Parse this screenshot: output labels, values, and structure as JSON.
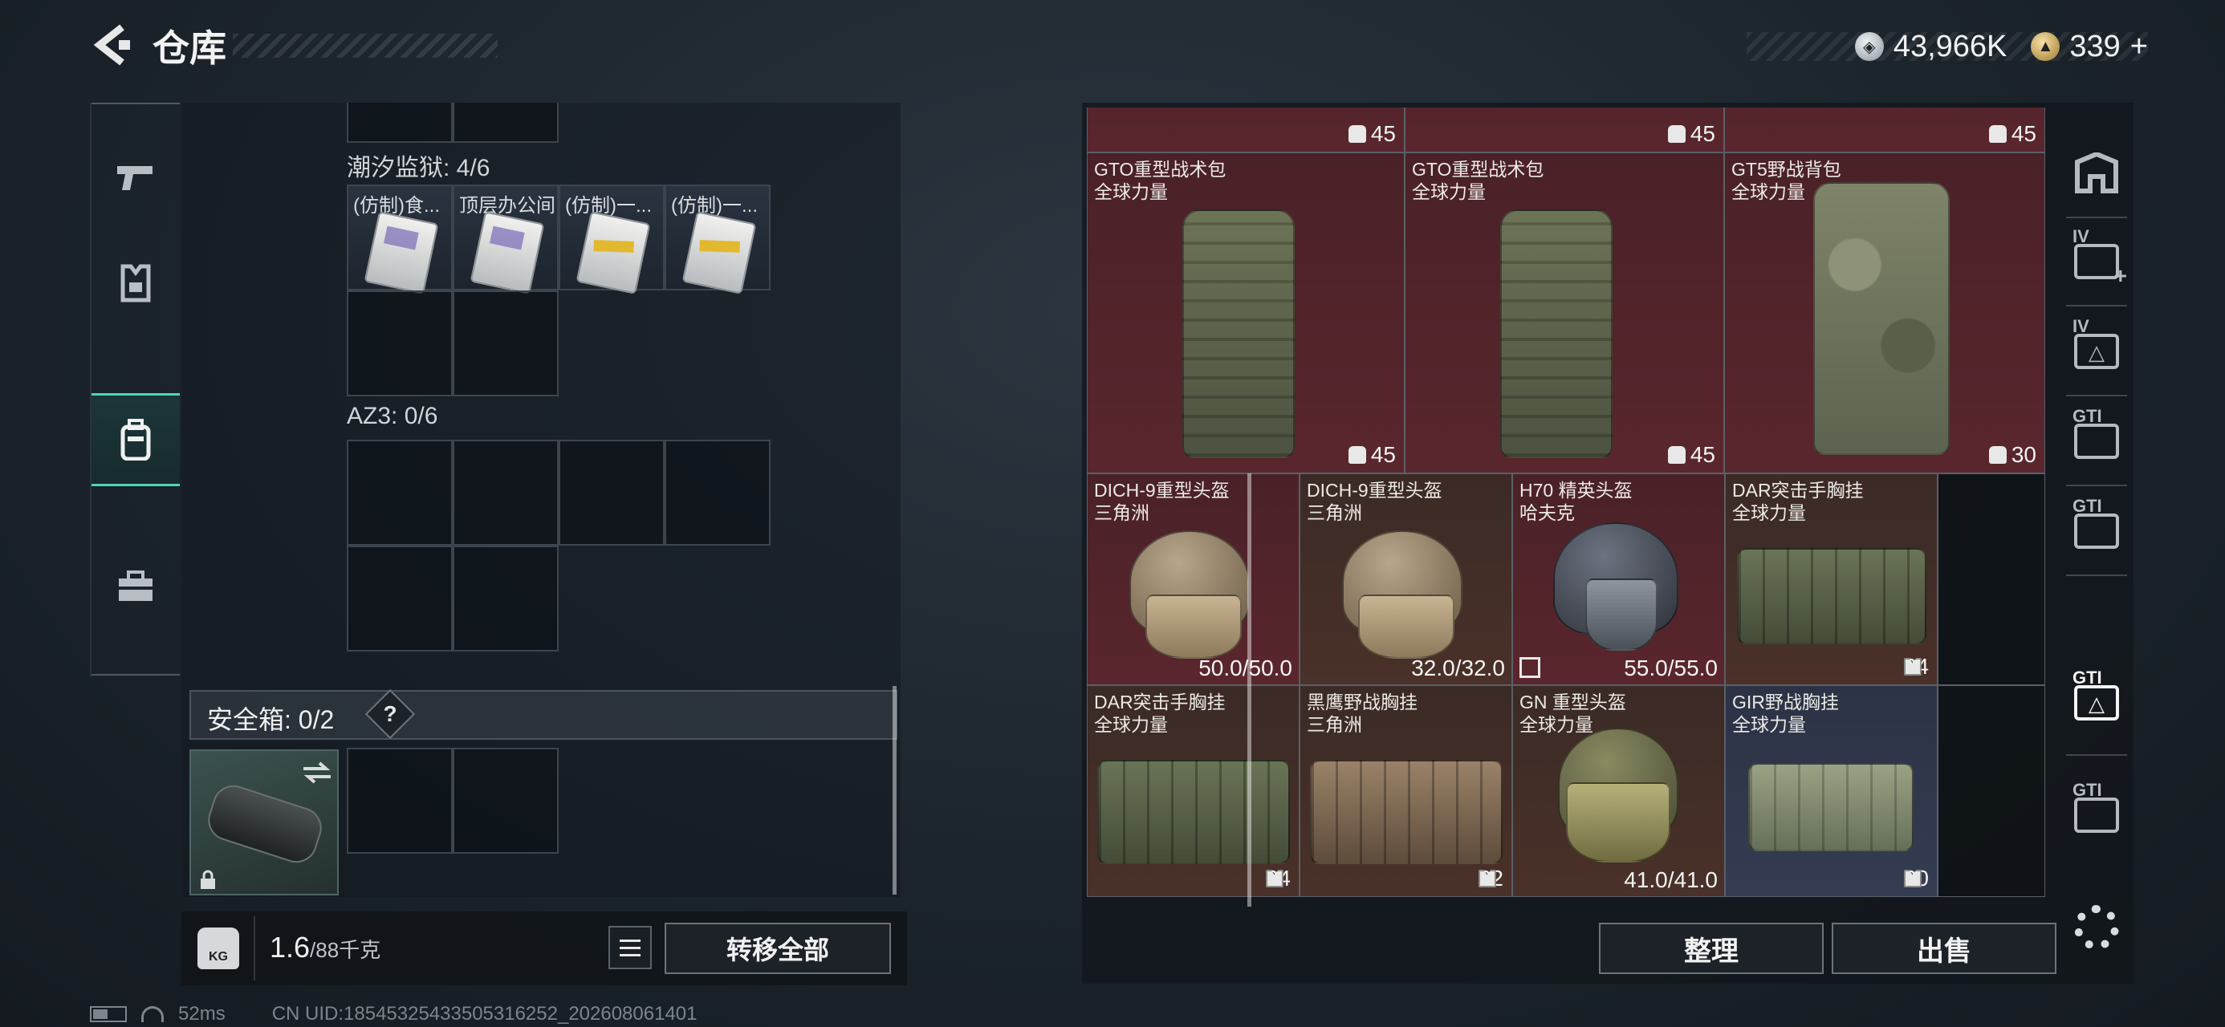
{
  "header": {
    "title": "仓库",
    "currency": [
      {
        "icon": "silver-coin-icon",
        "value": "43,966K"
      },
      {
        "icon": "gold-coin-icon",
        "value": "339",
        "suffix": "+"
      }
    ]
  },
  "left_rail": {
    "items": [
      {
        "icon": "pistol-icon",
        "active": false
      },
      {
        "icon": "armor-rig-icon",
        "active": false
      },
      {
        "icon": "backpack-icon",
        "active": true
      },
      {
        "icon": "toolbox-icon",
        "active": false
      }
    ]
  },
  "containers": [
    {
      "label": "潮汐监狱: 4/6",
      "items": [
        "(仿制)食...",
        "顶层办公间",
        "(仿制)一...",
        "(仿制)一..."
      ]
    },
    {
      "label": "AZ3: 0/6",
      "items": []
    }
  ],
  "safebox": {
    "label": "安全箱: 0/2",
    "help": "?"
  },
  "footer_bar": {
    "weight_icon_text": "KG",
    "weight_current": "1.6",
    "weight_max": "/88千克",
    "transfer_all": "转移全部"
  },
  "stash": {
    "top_row_badges": [
      "45",
      "45",
      "45"
    ],
    "items": [
      {
        "name": "GTO重型战术包",
        "faction": "全球力量",
        "value": "45",
        "kind": "backpack",
        "bg": "red"
      },
      {
        "name": "GTO重型战术包",
        "faction": "全球力量",
        "value": "45",
        "kind": "backpack",
        "bg": "red"
      },
      {
        "name": "GT5野战背包",
        "faction": "全球力量",
        "value": "30",
        "kind": "backpack-camo",
        "bg": "red"
      },
      {
        "name": "DICH-9重型头盔",
        "faction": "三角洲",
        "value": "50.0/50.0",
        "kind": "helmet-tan",
        "bg": "red"
      },
      {
        "name": "DICH-9重型头盔",
        "faction": "三角洲",
        "value": "32.0/32.0",
        "kind": "helmet-tan",
        "bg": "brown"
      },
      {
        "name": "H70 精英头盔",
        "faction": "哈夫克",
        "value": "55.0/55.0",
        "kind": "helmet-grey",
        "bg": "red"
      },
      {
        "name": "DAR突击手胸挂",
        "faction": "全球力量",
        "value": "24",
        "kind": "vest",
        "bg": "brown"
      },
      {
        "name": "DAR突击手胸挂",
        "faction": "全球力量",
        "value": "24",
        "kind": "vest",
        "bg": "brown"
      },
      {
        "name": "黑鹰野战胸挂",
        "faction": "三角洲",
        "value": "22",
        "kind": "vest-tan",
        "bg": "brown"
      },
      {
        "name": "GN 重型头盔",
        "faction": "全球力量",
        "value": "41.0/41.0",
        "kind": "helmet-olive",
        "bg": "brown"
      },
      {
        "name": "GIR野战胸挂",
        "faction": "全球力量",
        "value": "20",
        "kind": "vest-light",
        "bg": "blue"
      }
    ]
  },
  "actions": {
    "sort": "整理",
    "sell": "出售"
  },
  "right_rail": {
    "items": [
      {
        "icon": "armor-plate-icon",
        "label": ""
      },
      {
        "icon": "add-slot-icon",
        "label": "IV"
      },
      {
        "icon": "hazard-slot-icon",
        "label": "IV"
      },
      {
        "icon": "gti-slot-icon",
        "label": "GTI"
      },
      {
        "icon": "gti-slot-icon",
        "label": "GTI"
      },
      {
        "icon": "gti-hazard-icon",
        "label": "GTI"
      },
      {
        "icon": "gti-slot-icon",
        "label": "GTI"
      }
    ]
  },
  "status": {
    "ping": "52ms",
    "uid": "CN UID:18545325433505316252_202608061401"
  }
}
